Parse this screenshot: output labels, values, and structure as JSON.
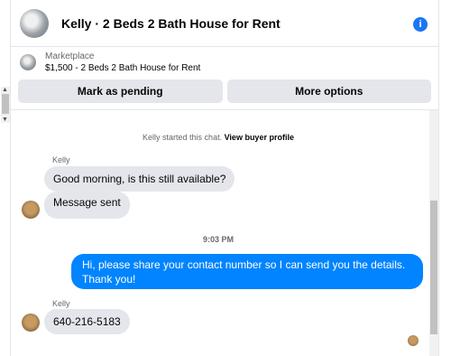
{
  "header": {
    "title": "Kelly · 2 Beds 2 Bath House for Rent",
    "info_icon": "info-icon",
    "info_glyph": "i"
  },
  "listing": {
    "source": "Marketplace",
    "summary": "$1,500 - 2 Beds 2 Bath House for Rent"
  },
  "actions": {
    "mark_pending": "Mark as pending",
    "more_options": "More options"
  },
  "chat": {
    "started_text": "Kelly started this chat.",
    "buyer_profile_link": "View buyer profile",
    "messages": [
      {
        "sender": "Kelly",
        "text": "Good morning, is this still available?"
      },
      {
        "text": "Message sent"
      },
      {
        "timestamp": "9:03 PM"
      },
      {
        "text": "Hi, please share your contact number so I can send you the details. Thank you!"
      },
      {
        "sender": "Kelly",
        "text": "640-216-5183"
      }
    ]
  },
  "colors": {
    "accent": "#1877f2",
    "outgoing_bubble": "#0084ff",
    "incoming_bubble": "#e4e6eb",
    "button_bg": "#e4e6eb"
  }
}
